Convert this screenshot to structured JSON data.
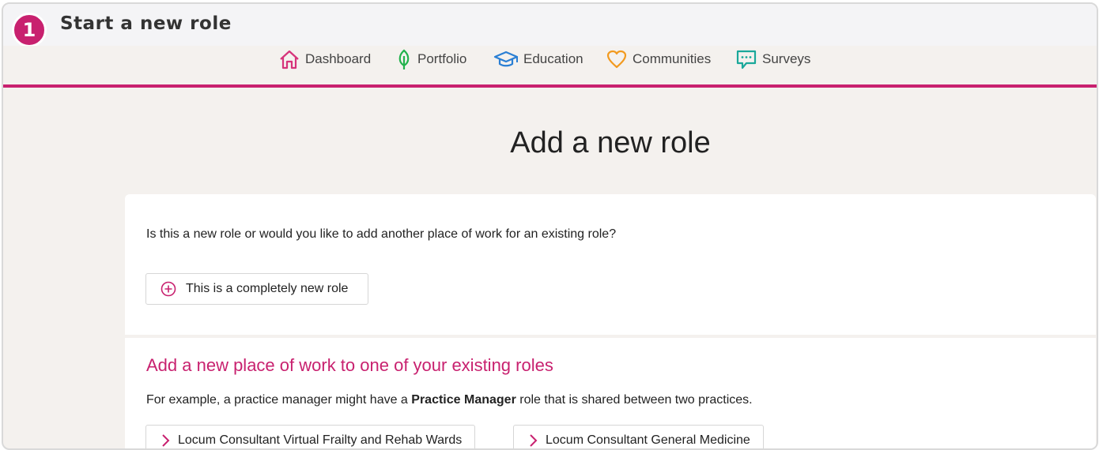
{
  "step": {
    "number": "1",
    "title": "Start a new role"
  },
  "nav": {
    "items": [
      {
        "label": "Dashboard",
        "icon": "home-icon",
        "color": "#d6337a"
      },
      {
        "label": "Portfolio",
        "icon": "leaf-icon",
        "color": "#22b24c"
      },
      {
        "label": "Education",
        "icon": "graduation-cap-icon",
        "color": "#2a7fd4"
      },
      {
        "label": "Communities",
        "icon": "heart-icon",
        "color": "#f29a1f"
      },
      {
        "label": "Surveys",
        "icon": "speech-bubble-icon",
        "color": "#1aa89a"
      }
    ]
  },
  "page_title": "Add a new role",
  "question": "Is this a new role or would you like to add another place of work for an existing role?",
  "new_role_button": "This is a completely new role",
  "existing": {
    "heading": "Add a new place of work to one of your existing roles",
    "example_prefix": "For example, a practice manager might have a ",
    "example_bold": "Practice Manager",
    "example_suffix": " role that is shared between two practices.",
    "roles": [
      "Locum Consultant Virtual Frailty and Rehab Wards",
      "Locum Consultant General Medicine"
    ]
  },
  "colors": {
    "accent": "#c8216f",
    "background": "#f4f1ee"
  }
}
